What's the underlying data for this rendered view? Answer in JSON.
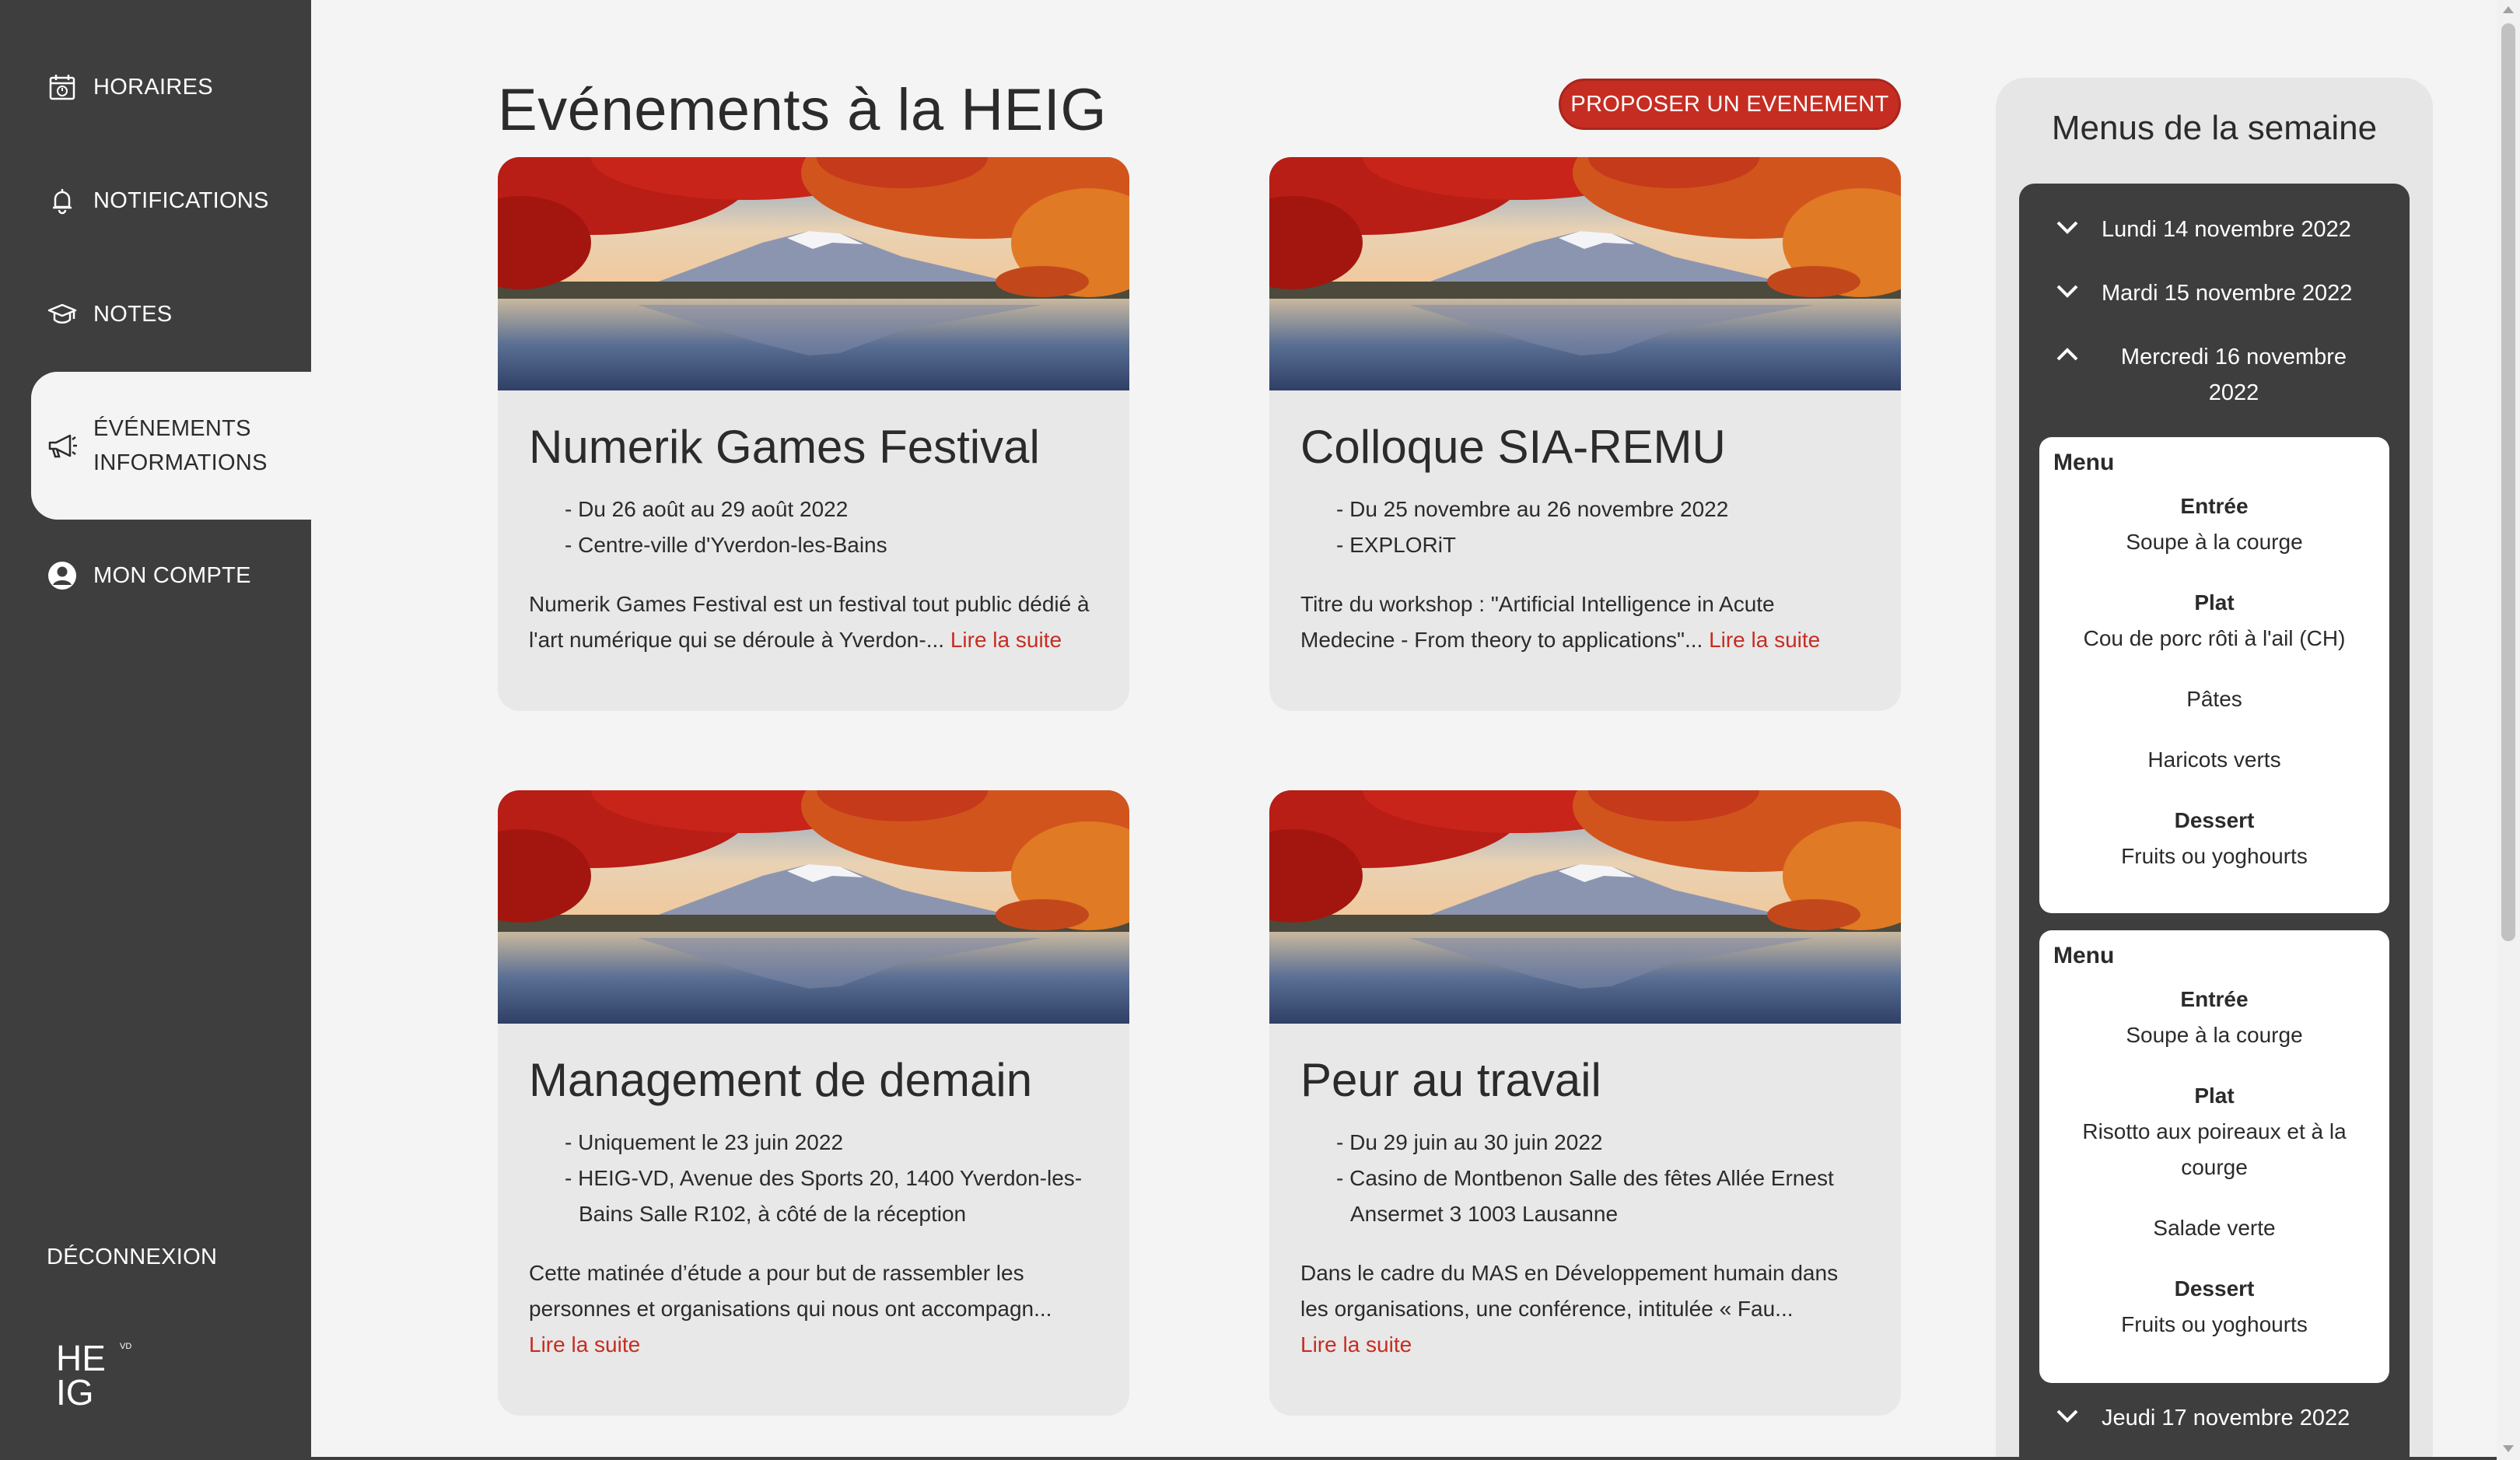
{
  "nav": {
    "horaires": "HORAIRES",
    "notifications": "NOTIFICATIONS",
    "notes": "NOTES",
    "evenements_line1": "ÉVÉNEMENTS",
    "evenements_line2": "INFORMATIONS",
    "compte": "MON COMPTE",
    "logout": "DÉCONNEXION"
  },
  "logo": {
    "line1": "HE",
    "line2": "IG",
    "suffix": "VD"
  },
  "main": {
    "title": "Evénements à la HEIG",
    "propose_button": "PROPOSER UN EVENEMENT",
    "read_more": "Lire la suite"
  },
  "events": [
    {
      "title": "Numerik Games Festival",
      "details": [
        "- Du 26 août au 29 août 2022",
        "- Centre-ville d'Yverdon-les-Bains"
      ],
      "description": "Numerik Games Festival est un festival tout public dédié à l'art numérique qui se déroule à Yverdon-...",
      "image": "autumn-lake-mountain"
    },
    {
      "title": "Colloque SIA-REMU",
      "details": [
        "- Du 25 novembre au 26 novembre 2022",
        "- EXPLORiT"
      ],
      "description": "Titre du workshop : \"Artificial Intelligence in Acute Medecine - From theory to applications\"...",
      "image": "autumn-lake-mountain"
    },
    {
      "title": "Management de demain",
      "details": [
        "- Uniquement le 23 juin 2022",
        "- HEIG-VD, Avenue des Sports 20, 1400 Yverdon-les-Bains Salle R102, à côté de la réception"
      ],
      "description": "Cette matinée d’étude a pour but de rassembler les personnes et organisations qui nous ont accompagn...",
      "image": "autumn-lake-mountain"
    },
    {
      "title": "Peur au travail",
      "details": [
        "- Du 29 juin au 30 juin 2022",
        "- Casino de Montbenon Salle des fêtes Allée Ernest Ansermet 3 1003 Lausanne"
      ],
      "description": "Dans le cadre du MAS en Développement humain dans les organisations, une conférence, intitulée « Fau...",
      "image": "autumn-lake-mountain"
    }
  ],
  "menus": {
    "title": "Menus de la semaine",
    "days": [
      {
        "label": "Lundi 14 novembre 2022",
        "open": false
      },
      {
        "label": "Mardi 15 novembre 2022",
        "open": false
      },
      {
        "label": "Mercredi 16 novembre 2022",
        "open": true
      },
      {
        "label": "Jeudi 17 novembre 2022",
        "open": false
      }
    ],
    "menu_label": "Menu",
    "menu1": {
      "entree_head": "Entrée",
      "entree": "Soupe à la courge",
      "plat_head": "Plat",
      "plat": [
        "Cou de porc rôti à l'ail (CH)",
        "Pâtes",
        "Haricots verts"
      ],
      "dessert_head": "Dessert",
      "dessert": "Fruits ou yoghourts"
    },
    "menu2": {
      "entree_head": "Entrée",
      "entree": "Soupe à la courge",
      "plat_head": "Plat",
      "plat": [
        "Risotto aux poireaux et à la courge",
        "Salade verte"
      ],
      "dessert_head": "Dessert",
      "dessert": "Fruits ou yoghourts"
    }
  },
  "colors": {
    "sidebar": "#3e3e3e",
    "accent": "#c62d22",
    "background": "#f4f4f4",
    "card": "#e8e8e8"
  }
}
